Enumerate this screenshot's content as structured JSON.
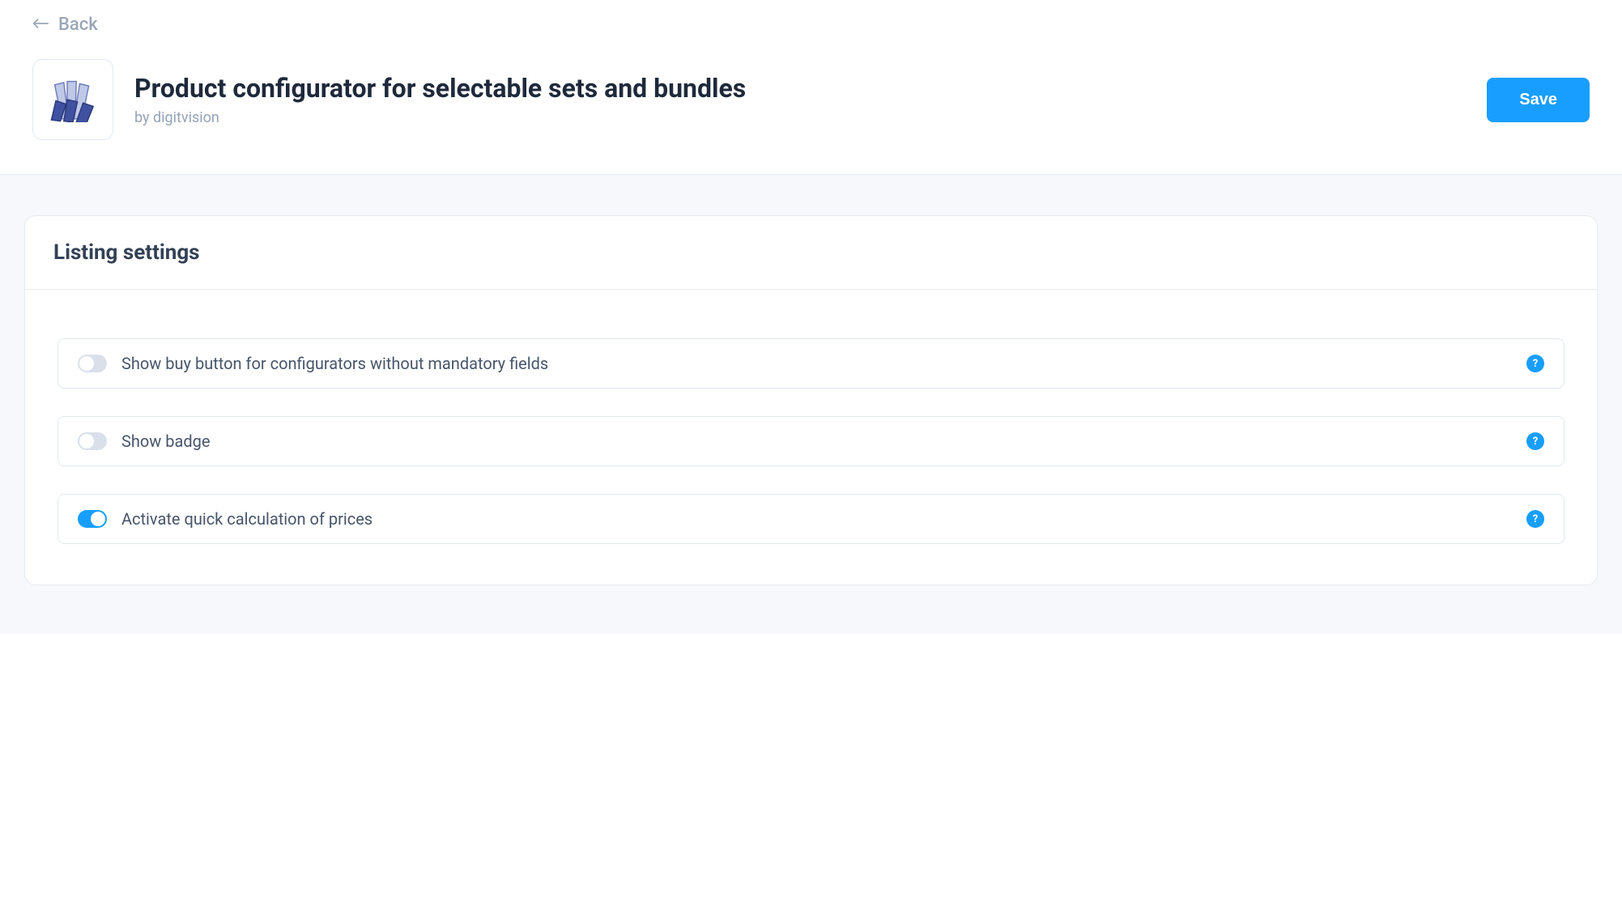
{
  "nav": {
    "back_label": "Back"
  },
  "header": {
    "title": "Product configurator for selectable sets and bundles",
    "by_prefix": "by ",
    "vendor": "digitvision",
    "save_label": "Save"
  },
  "card": {
    "title": "Listing settings",
    "settings": [
      {
        "label": "Show buy button for configurators without mandatory fields",
        "on": false
      },
      {
        "label": "Show badge",
        "on": false
      },
      {
        "label": "Activate quick calculation of prices",
        "on": true
      }
    ],
    "help_glyph": "?"
  }
}
